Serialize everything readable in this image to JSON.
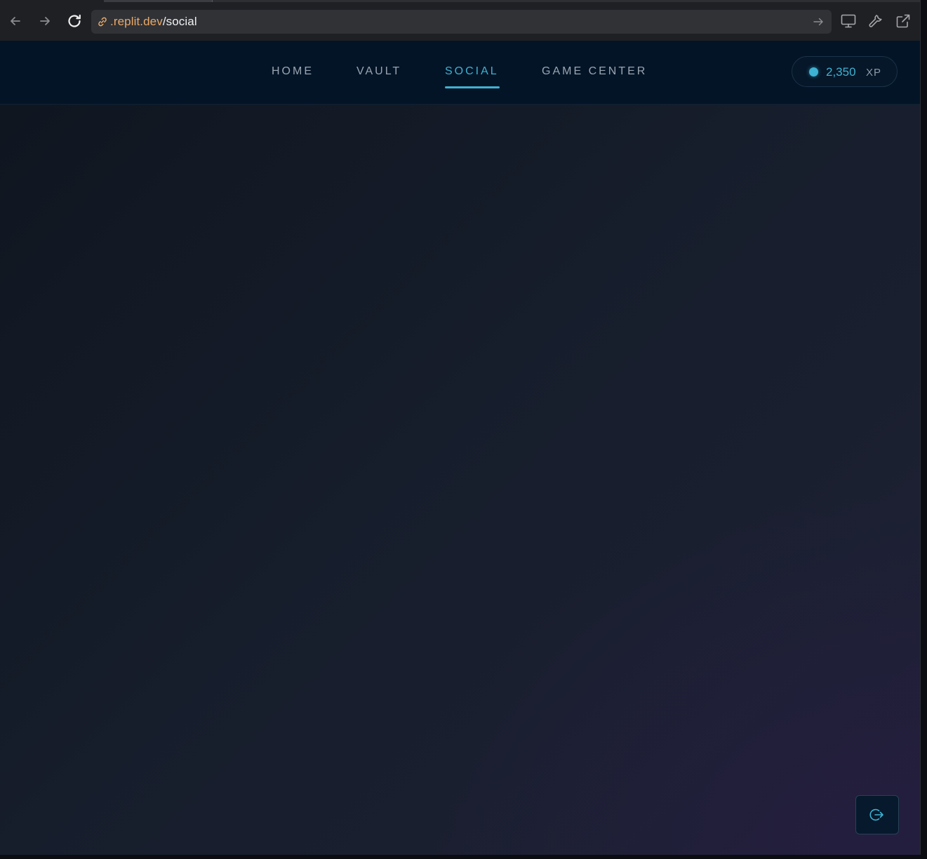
{
  "browser": {
    "url_domain": ".replit.dev",
    "url_path": "/social",
    "icons": {
      "back": "arrow-left-icon",
      "forward": "arrow-right-icon",
      "reload": "reload-icon",
      "link": "link-icon",
      "go": "arrow-right-icon",
      "devices": "monitor-icon",
      "devtools": "wrench-icon",
      "open_external": "external-link-icon"
    }
  },
  "nav": {
    "items": [
      {
        "label": "HOME",
        "active": false
      },
      {
        "label": "VAULT",
        "active": false
      },
      {
        "label": "SOCIAL",
        "active": true
      },
      {
        "label": "GAME CENTER",
        "active": false
      }
    ]
  },
  "xp": {
    "value": "2,350",
    "unit": "XP"
  },
  "actions": {
    "exit_icon": "logout-icon"
  },
  "colors": {
    "accent": "#3eb2d2",
    "header_bg": "#041427",
    "url_domain": "#e8a969"
  }
}
